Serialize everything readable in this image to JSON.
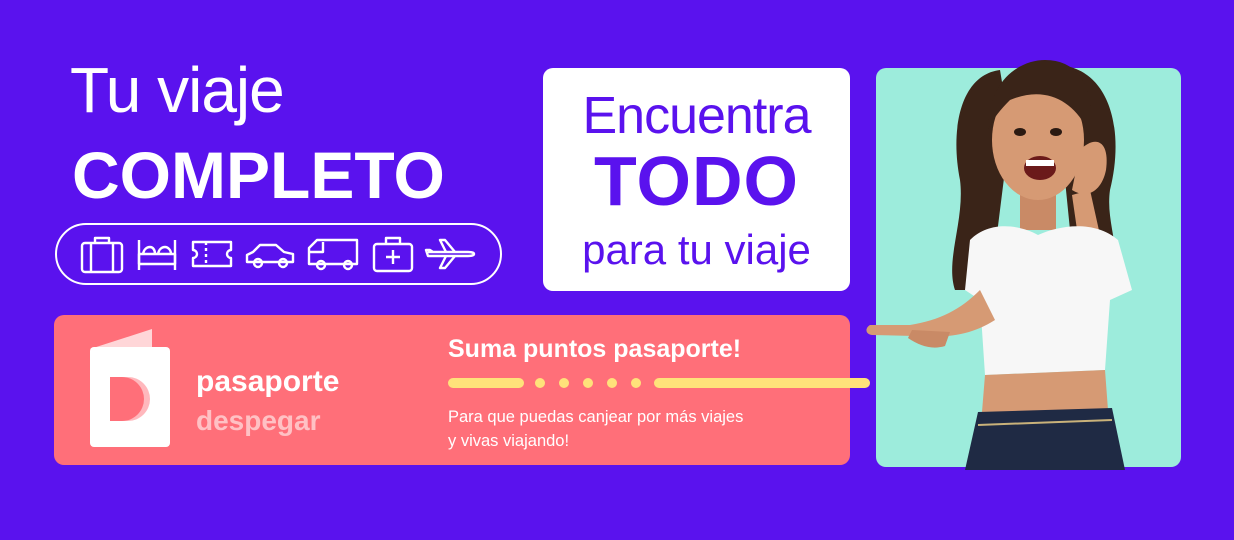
{
  "headline": {
    "line1": "Tu viaje",
    "line2": "COMPLETO"
  },
  "travel_icons": [
    "suitcase-icon",
    "bed-icon",
    "ticket-icon",
    "car-icon",
    "van-icon",
    "medical-kit-icon",
    "airplane-icon"
  ],
  "white_card": {
    "line1": "Encuentra",
    "line2": "TODO",
    "line3": "para tu viaje"
  },
  "pasaporte_card": {
    "brand_name": "pasaporte",
    "brand_sub": "despegar",
    "title": "Suma puntos pasaporte!",
    "description_line1": "Para que puedas canjear por más viajes",
    "description_line2": "y vivas viajando!"
  },
  "colors": {
    "background": "#5a12ee",
    "pink_card": "#ff6f79",
    "photo_panel": "#9decdc",
    "accent_yellow": "#ffe27a"
  }
}
